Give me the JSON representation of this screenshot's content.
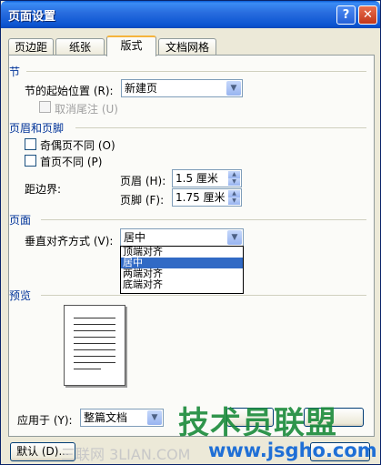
{
  "window": {
    "title": "页面设置",
    "help": "?",
    "close": "✕"
  },
  "tabs": [
    "页边距",
    "纸张",
    "版式",
    "文档网格"
  ],
  "section": {
    "title": "节",
    "start_label": "节的起始位置 (R):",
    "start_value": "新建页",
    "suppress_endnotes": "取消尾注 (U)"
  },
  "header_footer": {
    "title": "页眉和页脚",
    "odd_even": "奇偶页不同 (O)",
    "first_page": "首页不同 (P)",
    "distance_label": "距边界:",
    "header_label": "页眉 (H):",
    "header_value": "1.5 厘米",
    "footer_label": "页脚 (F):",
    "footer_value": "1.75 厘米"
  },
  "page": {
    "title": "页面",
    "valign_label": "垂直对齐方式 (V):",
    "valign_value": "居中",
    "options": [
      "顶端对齐",
      "居中",
      "两端对齐",
      "底端对齐"
    ],
    "selected_index": 1
  },
  "preview": {
    "title": "预览"
  },
  "apply": {
    "label": "应用于 (Y):",
    "value": "整篇文档"
  },
  "buttons": {
    "default": "默认 (D)..."
  },
  "watermarks": {
    "big": "技术员联盟",
    "url": "www.jsgho.com",
    "faint": "三联网 3LIAN.COM"
  },
  "colors": {
    "title_bar": "#2a6fe0",
    "section": "#003399",
    "selection": "#316ac5"
  }
}
